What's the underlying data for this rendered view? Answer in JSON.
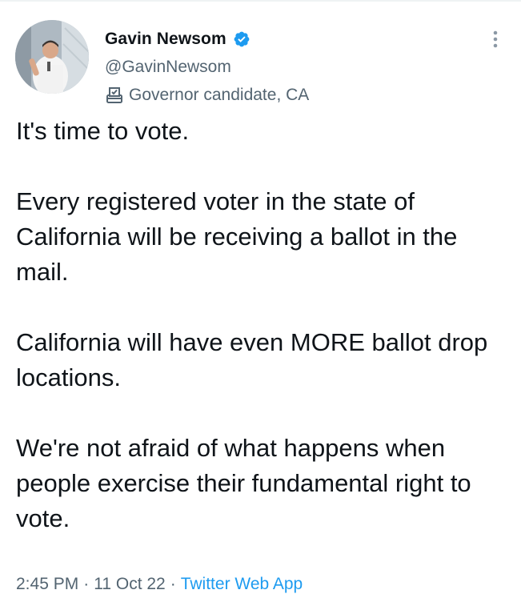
{
  "author": {
    "display_name": "Gavin Newsom",
    "handle": "@GavinNewsom",
    "verified": true,
    "label": "Governor candidate, CA",
    "label_icon": "ballot-box-icon",
    "avatar": "avatar-photo"
  },
  "tweet": {
    "paragraphs": [
      "It's time to vote.",
      "Every registered voter in the state of California will be receiving a ballot in the mail.",
      "California will have even MORE ballot drop locations.",
      "We're not afraid of what happens when people exercise their fundamental right to vote."
    ]
  },
  "meta": {
    "time": "2:45 PM",
    "separator": "·",
    "date": "11 Oct 22",
    "source": "Twitter Web App"
  },
  "icons": {
    "more": "more-options-icon",
    "verified": "verified-badge-icon"
  },
  "colors": {
    "text": "#0f1419",
    "secondary": "#536471",
    "accent": "#1d9bf0"
  }
}
